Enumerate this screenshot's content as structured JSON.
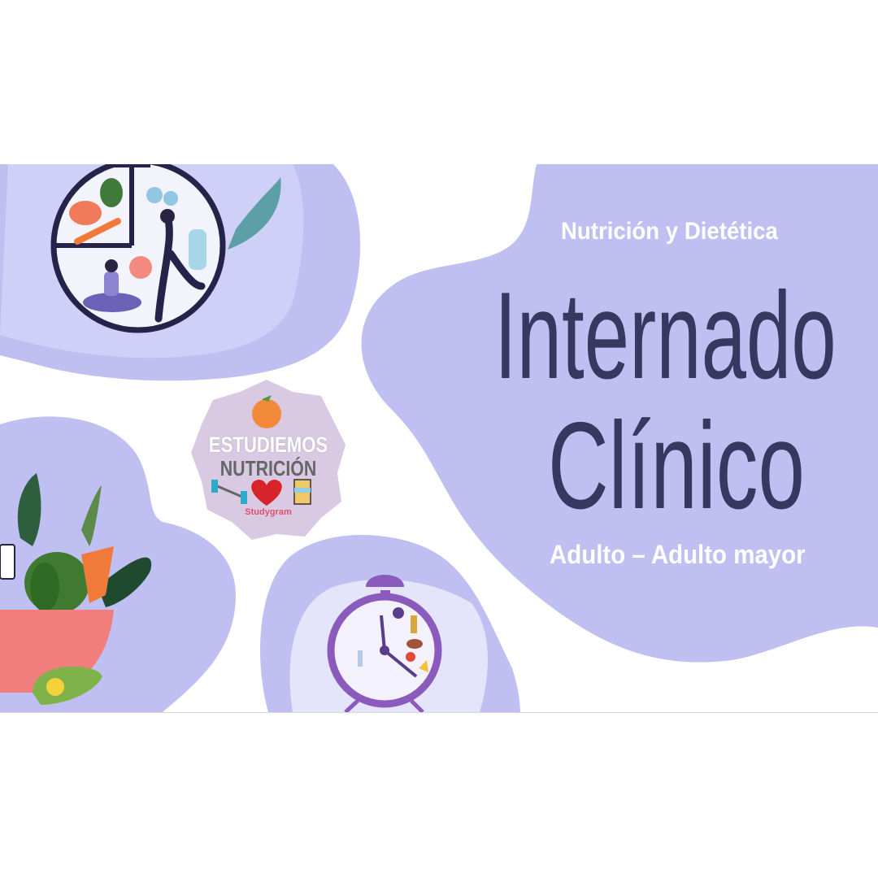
{
  "slide": {
    "subtitle_top": "Nutrición y Dietética",
    "title_line1": "Internado",
    "title_line2": "Clínico",
    "subtitle_bottom": "Adulto – Adulto mayor"
  },
  "badge": {
    "line1": "ESTUDIEMOS",
    "line2": "NUTRICIÓN",
    "brand": "Studygram"
  },
  "colors": {
    "blob": "#bfc0f1",
    "title": "#37375f",
    "badge_bg": "#d9c9e3",
    "clock": "#8a5bbd"
  },
  "icons": [
    "plate-clock-illustration",
    "vegetable-bowl-illustration",
    "alarm-clock-illustration",
    "orange-icon",
    "dumbbell-icon",
    "heart-pulse-icon",
    "waist-icon"
  ]
}
